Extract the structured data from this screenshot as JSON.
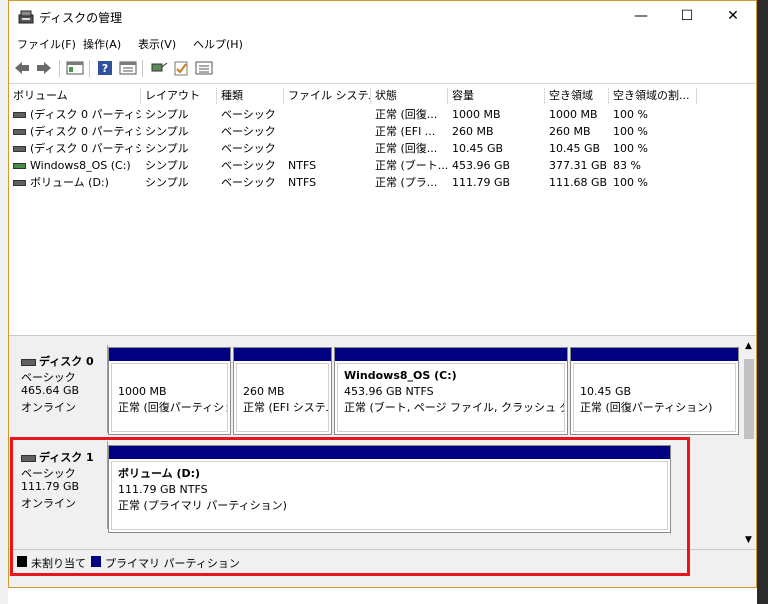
{
  "window": {
    "title": "ディスクの管理"
  },
  "menu": [
    "ファイル(F)",
    "操作(A)",
    "表示(V)",
    "ヘルプ(H)"
  ],
  "columns": [
    "ボリューム",
    "レイアウト",
    "種類",
    "ファイル システム",
    "状態",
    "容量",
    "空き領域",
    "空き領域の割..."
  ],
  "rows": [
    {
      "volume": "(ディスク 0 パーティシ...",
      "layout": "シンプル",
      "type": "ベーシック",
      "fs": "",
      "status": "正常 (回復...",
      "capacity": "1000 MB",
      "free": "1000 MB",
      "pct": "100 %"
    },
    {
      "volume": "(ディスク 0 パーティシ...",
      "layout": "シンプル",
      "type": "ベーシック",
      "fs": "",
      "status": "正常 (EFI ...",
      "capacity": "260 MB",
      "free": "260 MB",
      "pct": "100 %"
    },
    {
      "volume": "(ディスク 0 パーティシ...",
      "layout": "シンプル",
      "type": "ベーシック",
      "fs": "",
      "status": "正常 (回復...",
      "capacity": "10.45 GB",
      "free": "10.45 GB",
      "pct": "100 %"
    },
    {
      "volume": "Windows8_OS (C:)",
      "layout": "シンプル",
      "type": "ベーシック",
      "fs": "NTFS",
      "status": "正常 (ブート...",
      "capacity": "453.96 GB",
      "free": "377.31 GB",
      "pct": "83 %"
    },
    {
      "volume": "ボリューム (D:)",
      "layout": "シンプル",
      "type": "ベーシック",
      "fs": "NTFS",
      "status": "正常 (プラ...",
      "capacity": "111.79 GB",
      "free": "111.68 GB",
      "pct": "100 %"
    }
  ],
  "disks": [
    {
      "name": "ディスク 0",
      "kind": "ベーシック",
      "size": "465.64 GB",
      "state": "オンライン",
      "partitions": [
        {
          "title": "",
          "line1": "1000 MB",
          "line2": "正常 (回復パーティション)"
        },
        {
          "title": "",
          "line1": "260 MB",
          "line2": "正常 (EFI システム パーティション)"
        },
        {
          "title": "Windows8_OS  (C:)",
          "line1": "453.96 GB NTFS",
          "line2": "正常 (ブート, ページ ファイル, クラッシュ ダンプ, プライマリ パーティション)"
        },
        {
          "title": "",
          "line1": "10.45 GB",
          "line2": "正常 (回復パーティション)"
        }
      ]
    },
    {
      "name": "ディスク 1",
      "kind": "ベーシック",
      "size": "111.79 GB",
      "state": "オンライン",
      "partitions": [
        {
          "title": "ボリューム  (D:)",
          "line1": "111.79 GB NTFS",
          "line2": "正常 (プライマリ パーティション)"
        }
      ]
    }
  ],
  "legend": [
    {
      "label": "未割り当て",
      "color": "#000000"
    },
    {
      "label": "プライマリ パーティション",
      "color": "#000080"
    }
  ],
  "colors": {
    "partition_bar": "#000080",
    "highlight": "#e8141e",
    "title_border": "#d49a32"
  },
  "icons": [
    "disk-management-app-icon",
    "minimize-icon",
    "maximize-icon",
    "close-icon",
    "back-arrow-icon",
    "forward-arrow-icon",
    "view-icon",
    "help-icon",
    "properties-icon",
    "connect-icon",
    "check-icon",
    "list-icon"
  ]
}
